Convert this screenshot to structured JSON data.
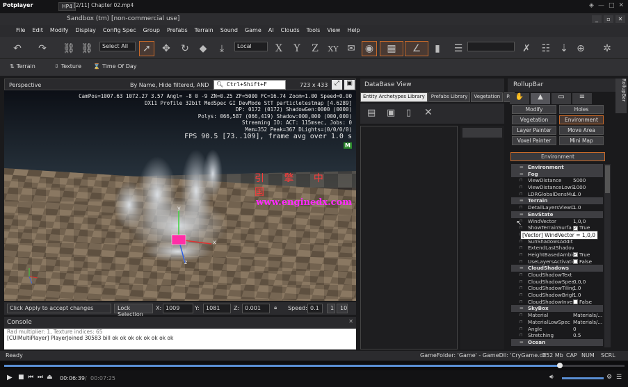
{
  "player": {
    "app_name": "Potplayer",
    "format_tab": "HP4",
    "file_title": "[2/11] Chapter 02.mp4"
  },
  "app": {
    "title": "Sandbox (tm) [non-commercial use]",
    "title_prefix_hidden": "S"
  },
  "menu": [
    "File",
    "Edit",
    "Modify",
    "Display",
    "Config Spec",
    "Group",
    "Prefabs",
    "Terrain",
    "Sound",
    "Game",
    "AI",
    "Clouds",
    "Tools",
    "View",
    "Help"
  ],
  "toolbar": {
    "select_all": "Select All",
    "coord_system": "Local",
    "axes": [
      "X",
      "Y",
      "Z",
      "XY"
    ]
  },
  "toolbar2": {
    "terrain": "Terrain",
    "texture": "Texture",
    "time_of_day": "Time Of Day"
  },
  "viewport": {
    "title": "Perspective",
    "filter": "By Name, Hide filtered, AND",
    "search": "Ctrl+Shift+F",
    "resolution": "723 x 433",
    "hud": [
      "CamPos=1007.63 1072.27 3.57 Angl= -8  0  -9 ZN=0.25 ZF=5000 FC=16.74 Zoom=1.00 Speed=0.00",
      "DX11 Profile 32bit MedSpec GI DevMode StT particletestmap [4.6289]",
      "DP: 0172 (0172) ShadowGen:0000 (0000)",
      "Polys: 066,587 (066,419) Shadow:000,000 (000,000)",
      "Streaming IO: ACT: 115msec, Jobs: 0",
      "Mem=352 Peak=367 DLights=(0/0/0/0)"
    ],
    "fps": "FPS 90.5 [73..109], frame avg over 1.0 s",
    "badge": "M",
    "watermark_cn": "引 擎 中 国",
    "watermark_url": "www.enginedx.com",
    "axis_x": "x",
    "axis_y": "y",
    "axis_z": "z"
  },
  "status_row": {
    "hint": "Click Apply to accept changes",
    "lock": "Lock Selection",
    "x_label": "X:",
    "x_val": "1009",
    "y_label": "Y:",
    "y_val": "1081",
    "z_label": "Z:",
    "z_val": "0.001",
    "speed_label": "Speed:",
    "speed_val": "0.1",
    "speed_1": "1",
    "speed_10": "10"
  },
  "console": {
    "title": "Console",
    "lines": [
      "Rad multiplier: 1, Texture indices: 65",
      "[CUIMultiPlayer] PlayerJoined 30583 bill ok ok ok ok ok ok ok ok"
    ]
  },
  "database": {
    "title": "DataBase View",
    "tabs": [
      "Entity Archetypes Library",
      "Prefabs Library",
      "Vegetation",
      "Pa"
    ]
  },
  "rollup": {
    "title": "RollupBar",
    "side_tab": "RollupBar",
    "buttons": [
      "Modify",
      "Holes",
      "Vegetation",
      "Environment",
      "Layer Painter",
      "Move Area",
      "Voxel Painter",
      "Mini Map"
    ],
    "panel_title": "Environment",
    "properties": [
      {
        "type": "sec",
        "name": "Environment"
      },
      {
        "type": "sec",
        "name": "Fog"
      },
      {
        "name": "ViewDistance",
        "value": "5000"
      },
      {
        "name": "ViewDistanceLowS",
        "value": "1000"
      },
      {
        "name": "LDRGlobalDensMul",
        "value": "1.0"
      },
      {
        "type": "sec",
        "name": "Terrain"
      },
      {
        "name": "DetailLayersViewD",
        "value": "1.0"
      },
      {
        "type": "sec",
        "name": "EnvState"
      },
      {
        "name": "WindVector",
        "value": "1,0,0"
      },
      {
        "name": "ShowTerrainSurfa",
        "value": "True",
        "check": true
      },
      {
        "name": "",
        "value": ""
      },
      {
        "name": "SunShadowsAddit",
        "value": ""
      },
      {
        "name": "ExtendLastShadov",
        "value": ""
      },
      {
        "name": "HeightBasedAmbie",
        "value": "True",
        "check": true
      },
      {
        "name": "UseLayersActivatic",
        "value": "False",
        "check": false
      },
      {
        "type": "sec",
        "name": "CloudShadows"
      },
      {
        "name": "CloudShadowText",
        "value": ""
      },
      {
        "name": "CloudShadowSpee",
        "value": "0,0,0"
      },
      {
        "name": "CloudShadowTiling",
        "value": "1.0"
      },
      {
        "name": "CloudShadowBrigh",
        "value": "1.0"
      },
      {
        "name": "CloudShadowInver",
        "value": "False",
        "check": false
      },
      {
        "type": "sec",
        "name": "SkyBox"
      },
      {
        "name": "Material",
        "value": "Materials/..."
      },
      {
        "name": "MaterialLowSpec",
        "value": "Materials/..."
      },
      {
        "name": "Angle",
        "value": "0"
      },
      {
        "name": "Stretching",
        "value": "0.5"
      },
      {
        "type": "sec",
        "name": "Ocean"
      }
    ],
    "tooltip": "[Vector] WindVector = 1,0,0"
  },
  "statusbar": {
    "ready": "Ready",
    "game_info": "GameFolder: 'Game' - GameDll: 'CryGame.dll'",
    "mem": "352 Mb",
    "cap": "CAP",
    "num": "NUM",
    "scrl": "SCRL"
  },
  "playback": {
    "current": "00:06:39",
    "total": "00:07:25",
    "progress": 0.896
  },
  "colors": {
    "accent": "#c86a2a",
    "panel": "#2b2b2e",
    "seek": "#5a8fd4"
  }
}
